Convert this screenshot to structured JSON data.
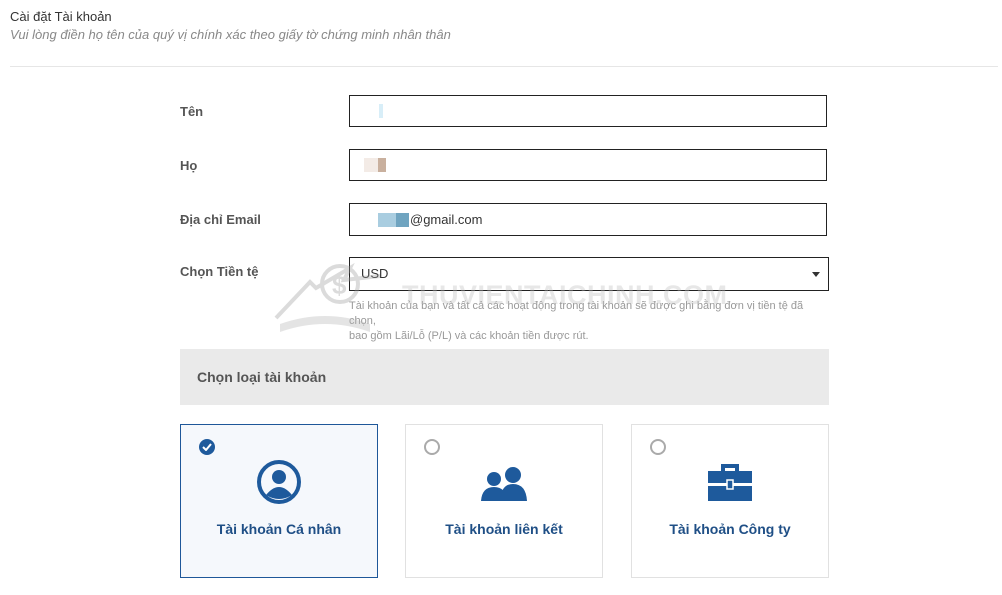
{
  "header": {
    "title": "Cài đặt Tài khoản",
    "subtitle": "Vui lòng điền họ tên của quý vị chính xác theo giấy tờ chứng minh nhân thân"
  },
  "form": {
    "first_name_label": "Tên",
    "last_name_label": "Họ",
    "email_label": "Địa chỉ Email",
    "email_value": "@gmail.com",
    "currency_label": "Chọn Tiền tệ",
    "currency_value": "USD",
    "currency_help_line1": "Tài khoản của bạn và tất cả các hoạt động trong tài khoản sẽ được ghi bằng đơn vị tiền tệ đã chọn,",
    "currency_help_line2": "bao gồm Lãi/Lỗ (P/L) và các khoản tiền được rút."
  },
  "watermark": {
    "text": "THUVIENTAICHINH.COM"
  },
  "account_type": {
    "section_title": "Chọn loại tài khoản",
    "options": [
      {
        "label": "Tài khoản Cá nhân",
        "icon": "user-circle-icon",
        "selected": true
      },
      {
        "label": "Tài khoản liên kết",
        "icon": "users-icon",
        "selected": false
      },
      {
        "label": "Tài khoản Công ty",
        "icon": "briefcase-icon",
        "selected": false
      }
    ]
  },
  "colors": {
    "accent": "#1e5a9c",
    "label_text": "#1f4f86",
    "section_bg": "#eaeaea"
  }
}
